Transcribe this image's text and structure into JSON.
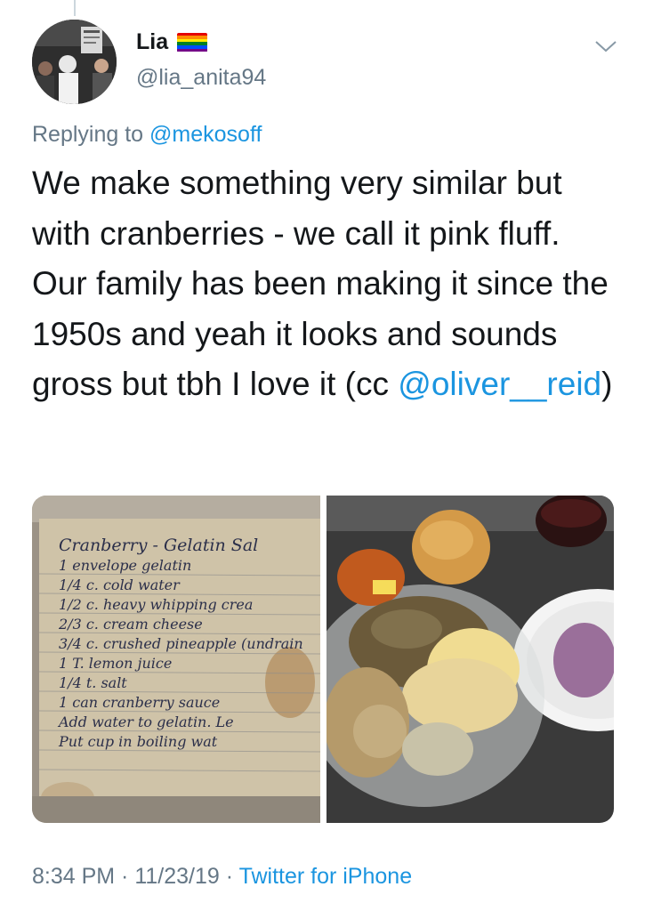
{
  "user": {
    "display_name": "Lia",
    "handle": "@lia_anita94",
    "flag_colors": [
      "#e40303",
      "#ff8c00",
      "#ffed00",
      "#008026",
      "#004dff",
      "#750787"
    ]
  },
  "reply": {
    "prefix": "Replying to ",
    "mention": "@mekosoff"
  },
  "tweet": {
    "text": "We make something very similar but with cranberries - we call it pink fluff. Our family has been making it since the 1950s and yeah it looks and sounds gross but tbh I love it (cc ",
    "mention": "@oliver__reid",
    "suffix": ")"
  },
  "recipe": {
    "lines": [
      "Cranberry - Gelatin Sal",
      "1 envelope gelatin",
      "1/4 c. cold water",
      "1/2 c. heavy whipping crea",
      "2/3 c. cream cheese",
      "3/4 c. crushed pineapple (undrain",
      "1 T. lemon juice",
      "1/4 t. salt",
      "1 can cranberry sauce",
      "Add water to gelatin. Le",
      "Put cup in boiling wat"
    ]
  },
  "meta": {
    "time": "8:34 PM",
    "sep1": " · ",
    "date": "11/23/19",
    "sep2": " · ",
    "source": "Twitter for iPhone"
  },
  "colors": {
    "text": "#14171a",
    "secondary": "#657786",
    "link": "#1b95e0"
  }
}
